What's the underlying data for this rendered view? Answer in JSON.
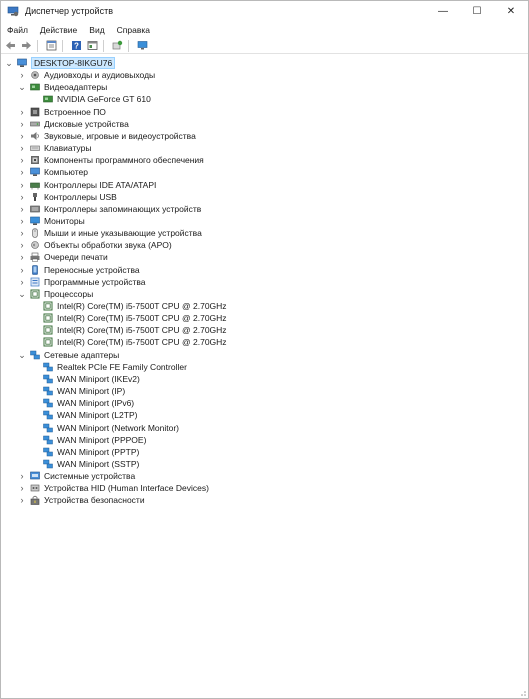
{
  "window": {
    "title": "Диспетчер устройств",
    "controls": {
      "minimize": "—",
      "maximize": "☐",
      "close": "✕"
    }
  },
  "menu": [
    "Файл",
    "Действие",
    "Вид",
    "Справка"
  ],
  "toolbar": [
    "back-icon",
    "forward-icon",
    "properties-icon",
    "help-icon",
    "view-icon",
    "scan-icon",
    "monitor-icon"
  ],
  "tree": {
    "root": "DESKTOP-8IKGU76",
    "categories": [
      {
        "label": "Аудиовходы и аудиовыходы",
        "icon": "audio-icon",
        "expanded": false,
        "children": []
      },
      {
        "label": "Видеоадаптеры",
        "icon": "display-adapter-icon",
        "expanded": true,
        "children": [
          "NVIDIA GeForce GT 610"
        ]
      },
      {
        "label": "Встроенное ПО",
        "icon": "firmware-icon",
        "expanded": false,
        "children": []
      },
      {
        "label": "Дисковые устройства",
        "icon": "disk-icon",
        "expanded": false,
        "children": []
      },
      {
        "label": "Звуковые, игровые и видеоустройства",
        "icon": "sound-icon",
        "expanded": false,
        "children": []
      },
      {
        "label": "Клавиатуры",
        "icon": "keyboard-icon",
        "expanded": false,
        "children": []
      },
      {
        "label": "Компоненты программного обеспечения",
        "icon": "software-component-icon",
        "expanded": false,
        "children": []
      },
      {
        "label": "Компьютер",
        "icon": "computer-icon",
        "expanded": false,
        "children": []
      },
      {
        "label": "Контроллеры IDE ATA/ATAPI",
        "icon": "ide-icon",
        "expanded": false,
        "children": []
      },
      {
        "label": "Контроллеры USB",
        "icon": "usb-icon",
        "expanded": false,
        "children": []
      },
      {
        "label": "Контроллеры запоминающих устройств",
        "icon": "storage-icon",
        "expanded": false,
        "children": []
      },
      {
        "label": "Мониторы",
        "icon": "monitor-icon",
        "expanded": false,
        "children": []
      },
      {
        "label": "Мыши и иные указывающие устройства",
        "icon": "mouse-icon",
        "expanded": false,
        "children": []
      },
      {
        "label": "Объекты обработки звука (APO)",
        "icon": "apo-icon",
        "expanded": false,
        "children": []
      },
      {
        "label": "Очереди печати",
        "icon": "printer-icon",
        "expanded": false,
        "children": []
      },
      {
        "label": "Переносные устройства",
        "icon": "portable-icon",
        "expanded": false,
        "children": []
      },
      {
        "label": "Программные устройства",
        "icon": "software-device-icon",
        "expanded": false,
        "children": []
      },
      {
        "label": "Процессоры",
        "icon": "processor-icon",
        "expanded": true,
        "children": [
          "Intel(R) Core(TM) i5-7500T CPU @ 2.70GHz",
          "Intel(R) Core(TM) i5-7500T CPU @ 2.70GHz",
          "Intel(R) Core(TM) i5-7500T CPU @ 2.70GHz",
          "Intel(R) Core(TM) i5-7500T CPU @ 2.70GHz"
        ]
      },
      {
        "label": "Сетевые адаптеры",
        "icon": "network-icon",
        "expanded": true,
        "children": [
          "Realtek PCIe FE Family Controller",
          "WAN Miniport (IKEv2)",
          "WAN Miniport (IP)",
          "WAN Miniport (IPv6)",
          "WAN Miniport (L2TP)",
          "WAN Miniport (Network Monitor)",
          "WAN Miniport (PPPOE)",
          "WAN Miniport (PPTP)",
          "WAN Miniport (SSTP)"
        ]
      },
      {
        "label": "Системные устройства",
        "icon": "system-icon",
        "expanded": false,
        "children": []
      },
      {
        "label": "Устройства HID (Human Interface Devices)",
        "icon": "hid-icon",
        "expanded": false,
        "children": []
      },
      {
        "label": "Устройства безопасности",
        "icon": "security-icon",
        "expanded": false,
        "children": []
      }
    ]
  }
}
